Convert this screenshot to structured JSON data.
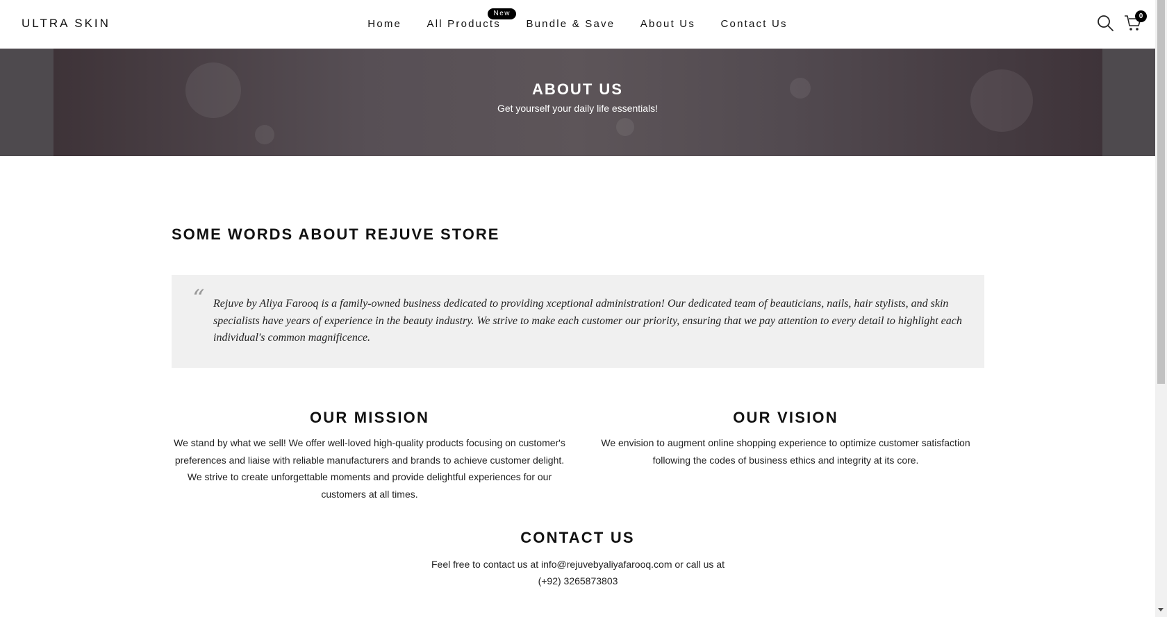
{
  "header": {
    "logo": "ULTRA SKIN",
    "nav": [
      {
        "label": "Home"
      },
      {
        "label": "All Products",
        "badge": "New"
      },
      {
        "label": "Bundle & Save"
      },
      {
        "label": "About Us"
      },
      {
        "label": "Contact Us"
      }
    ],
    "cart_count": "0",
    "icons": [
      "search-icon",
      "cart-icon"
    ]
  },
  "banner": {
    "title": "ABOUT US",
    "subtitle": "Get yourself your daily life essentials!"
  },
  "about": {
    "heading": "SOME WORDS ABOUT REJUVE STORE",
    "quote_mark": "“",
    "quote": "Rejuve by Aliya Farooq is a family-owned business dedicated to providing xceptional administration! Our dedicated team of beauticians, nails, hair stylists, and skin specialists have years of experience in the beauty industry. We strive to make each customer our priority, ensuring that we pay attention to every detail to highlight each individual's common magnificence."
  },
  "mission": {
    "title": "OUR MISSION",
    "text": "We stand by what we sell! We offer well-loved high-quality products focusing on customer's preferences and liaise with reliable manufacturers and brands to achieve customer delight. We strive to create unforgettable moments and provide delightful experiences for our customers at all times."
  },
  "vision": {
    "title": "OUR VISION",
    "text": "We envision to augment online shopping experience to optimize customer satisfaction following the codes of business ethics and integrity at its core."
  },
  "contact": {
    "title": "CONTACT US",
    "text": "Feel free to contact us at info@rejuvebyaliyafarooq.com or call us at (+92) 3265873803"
  }
}
